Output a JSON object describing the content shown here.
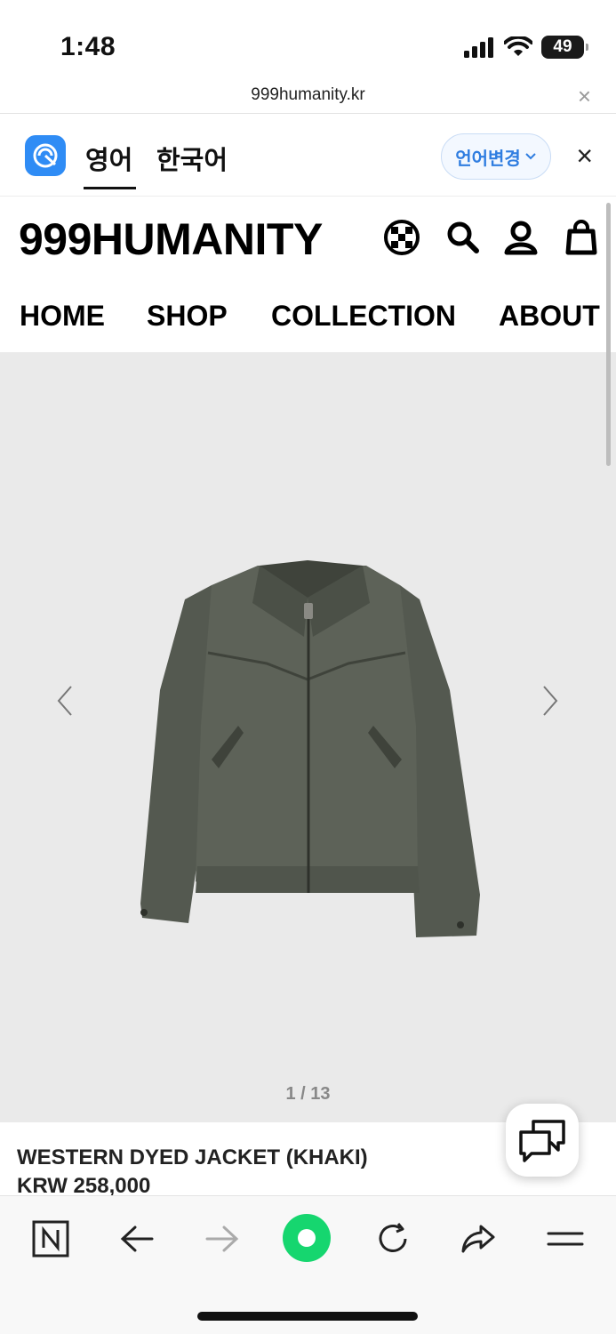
{
  "status_bar": {
    "time": "1:48",
    "battery": "49"
  },
  "url_bar": {
    "url": "999humanity.kr",
    "close_label": "×"
  },
  "translate_bar": {
    "tabs": [
      {
        "label": "영어"
      },
      {
        "label": "한국어"
      }
    ],
    "change_button": "언어변경",
    "close_label": "×",
    "logo_color": "#2f8cf5"
  },
  "header": {
    "logo": "999HUMANITY",
    "icons": [
      "globe-icon",
      "search-icon",
      "user-icon",
      "cart-icon"
    ]
  },
  "nav": {
    "items": [
      {
        "label": "HOME"
      },
      {
        "label": "SHOP"
      },
      {
        "label": "COLLECTION"
      },
      {
        "label": "ABOUT"
      }
    ]
  },
  "gallery": {
    "counter": "1 / 13",
    "background": "#eaeaea"
  },
  "product": {
    "name": "WESTERN DYED JACKET (KHAKI)",
    "price": "KRW 258,000"
  },
  "toolbar": {
    "icons": [
      "naver-icon",
      "back-icon",
      "forward-icon",
      "green-dot-icon",
      "reload-icon",
      "share-icon",
      "menu-icon"
    ],
    "accent": "#16d66f"
  }
}
